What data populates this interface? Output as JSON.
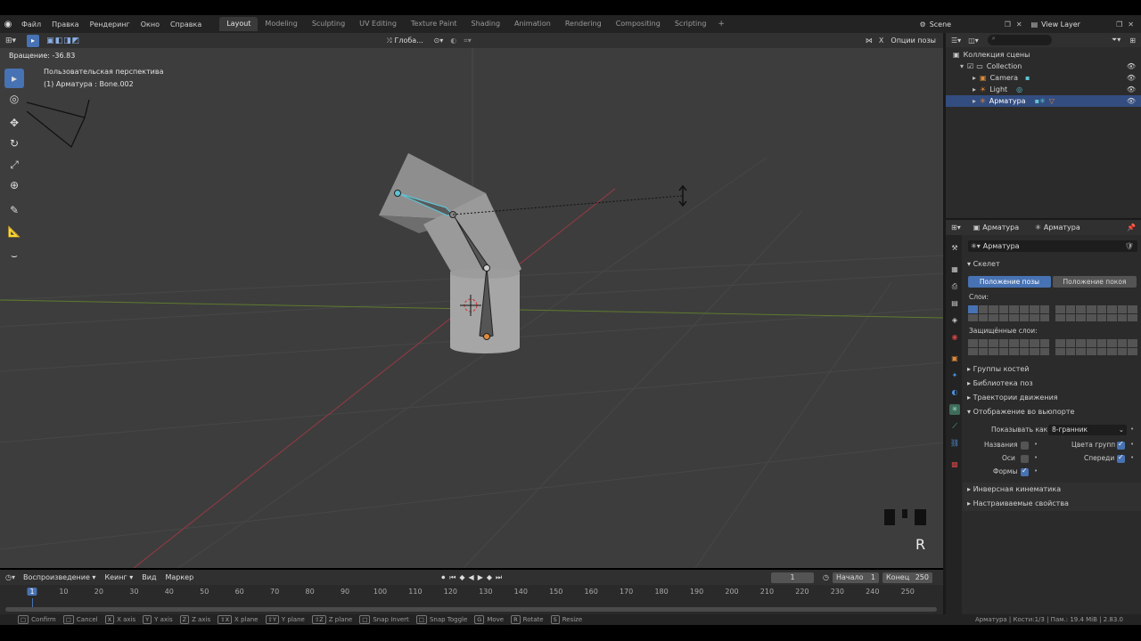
{
  "menu": {
    "items": [
      "Файл",
      "Правка",
      "Рендеринг",
      "Окно",
      "Справка"
    ],
    "workspaces": [
      "Layout",
      "Modeling",
      "Sculpting",
      "UV Editing",
      "Texture Paint",
      "Shading",
      "Animation",
      "Rendering",
      "Compositing",
      "Scripting"
    ],
    "active_workspace": "Layout",
    "scene": "Scene",
    "view_layer": "View Layer"
  },
  "viewport_header": {
    "transform_orientation": "Глоба...",
    "pose_options": "Опции позы",
    "operator_status": "Вращение: -36.83"
  },
  "viewport": {
    "view_name": "Пользовательская перспектива",
    "object_info": "(1) Арматура : Bone.002",
    "axis_key": "R"
  },
  "outliner": {
    "root": "Коллекция сцены",
    "collection": "Collection",
    "items": [
      {
        "name": "Camera",
        "icon": "camera-icon"
      },
      {
        "name": "Light",
        "icon": "light-icon"
      },
      {
        "name": "Арматура",
        "icon": "armature-icon",
        "selected": true
      }
    ]
  },
  "properties": {
    "header_object": "Арматура",
    "header_data": "Арматура",
    "data_name": "Арматура",
    "skeleton_section": "Скелет",
    "pose_position": "Положение позы",
    "rest_position": "Положение покоя",
    "layers_label": "Слои:",
    "protected_layers_label": "Защищённые слои:",
    "collapsed_sections": [
      "Группы костей",
      "Библиотека поз",
      "Траектории движения"
    ],
    "viewport_display_section": "Отображение во вьюпорте",
    "display_as_label": "Показывать как",
    "display_as_value": "8-гранник",
    "names_label": "Названия",
    "axes_label": "Оси",
    "shapes_label": "Формы",
    "group_colors_label": "Цвета групп",
    "in_front_label": "Спереди",
    "names_checked": false,
    "axes_checked": false,
    "shapes_checked": true,
    "group_colors_checked": true,
    "in_front_checked": true,
    "ik_section": "Инверсная кинематика",
    "custom_props_section": "Настраиваемые свойства"
  },
  "timeline": {
    "menus": [
      "Воспроизведение",
      "Кеинг",
      "Вид",
      "Маркер"
    ],
    "current_frame": "1",
    "start_label": "Начало",
    "start_value": "1",
    "end_label": "Конец",
    "end_value": "250",
    "ruler": [
      "1",
      "10",
      "20",
      "30",
      "40",
      "50",
      "60",
      "70",
      "80",
      "90",
      "100",
      "110",
      "120",
      "130",
      "140",
      "150",
      "160",
      "170",
      "180",
      "190",
      "200",
      "210",
      "220",
      "230",
      "240",
      "250"
    ]
  },
  "statusbar": {
    "hints": [
      {
        "key": "",
        "label": "Confirm"
      },
      {
        "key": "",
        "label": "Cancel"
      },
      {
        "key": "X",
        "label": "X axis"
      },
      {
        "key": "Y",
        "label": "Y axis"
      },
      {
        "key": "Z",
        "label": "Z axis"
      },
      {
        "key": "⇧X",
        "label": "X plane"
      },
      {
        "key": "⇧Y",
        "label": "Y plane"
      },
      {
        "key": "⇧Z",
        "label": "Z plane"
      },
      {
        "key": "",
        "label": "Snap Invert"
      },
      {
        "key": "",
        "label": "Snap Toggle"
      },
      {
        "key": "G",
        "label": "Move"
      },
      {
        "key": "R",
        "label": "Rotate"
      },
      {
        "key": "S",
        "label": "Resize"
      }
    ],
    "right": "Арматура | Кости:1/3 | Пам.: 19.4 MiB | 2.83.0"
  },
  "colors": {
    "accent": "#4772b3",
    "selected_row": "#334d80",
    "x_axis": "#8a3a45",
    "y_axis": "#6a8a2a",
    "bone_active": "#5ec4d4"
  }
}
